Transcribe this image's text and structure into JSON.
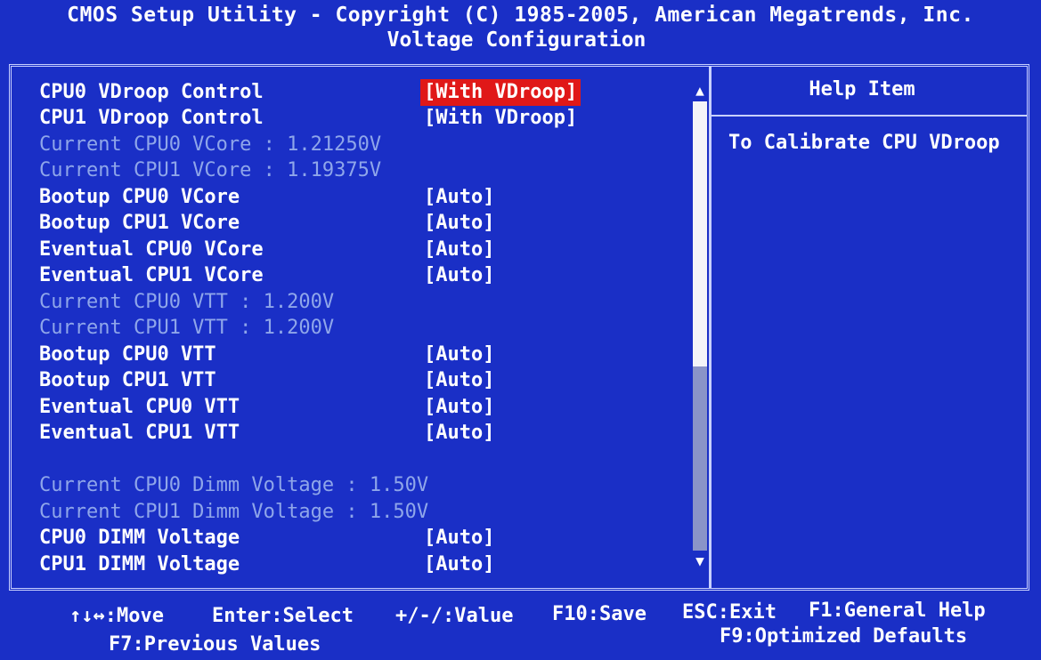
{
  "header": {
    "title": "CMOS Setup Utility - Copyright (C) 1985-2005, American Megatrends, Inc.",
    "subtitle": "Voltage Configuration"
  },
  "settings": [
    {
      "label": "CPU0 VDroop Control",
      "value": "[With VDroop]"
    },
    {
      "label": "CPU1 VDroop Control",
      "value": "[With VDroop]"
    },
    {
      "label": "Current CPU0 VCore : 1.21250V"
    },
    {
      "label": "Current CPU1 VCore : 1.19375V"
    },
    {
      "label": "Bootup CPU0 VCore",
      "value": "[Auto]"
    },
    {
      "label": "Bootup CPU1 VCore",
      "value": "[Auto]"
    },
    {
      "label": "Eventual CPU0 VCore",
      "value": "[Auto]"
    },
    {
      "label": "Eventual CPU1 VCore",
      "value": "[Auto]"
    },
    {
      "label": "Current CPU0 VTT : 1.200V"
    },
    {
      "label": "Current CPU1 VTT : 1.200V"
    },
    {
      "label": "Bootup CPU0 VTT",
      "value": "[Auto]"
    },
    {
      "label": "Bootup CPU1 VTT",
      "value": "[Auto]"
    },
    {
      "label": "Eventual CPU0 VTT",
      "value": "[Auto]"
    },
    {
      "label": "Eventual CPU1 VTT",
      "value": "[Auto]"
    },
    {
      "label": "Current CPU0 Dimm Voltage : 1.50V"
    },
    {
      "label": "Current CPU1 Dimm Voltage : 1.50V"
    },
    {
      "label": "CPU0 DIMM Voltage",
      "value": "[Auto]"
    },
    {
      "label": "CPU1 DIMM Voltage",
      "value": "[Auto]"
    }
  ],
  "help": {
    "title": "Help Item",
    "text": "To Calibrate CPU VDroop"
  },
  "footer": {
    "move": "↑↓↔:Move",
    "select": "Enter:Select",
    "value": "+/-/:Value",
    "save": "F10:Save",
    "exit": "ESC:Exit",
    "general_help": "F1:General Help",
    "previous": "F7:Previous Values",
    "optimized": "F9:Optimized Defaults"
  },
  "scrollbar": {
    "up_icon": "▲",
    "down_icon": "▼"
  },
  "colors": {
    "background": "#1a2fc6",
    "selected": "#e01818",
    "info_text": "#8fa6ea"
  }
}
